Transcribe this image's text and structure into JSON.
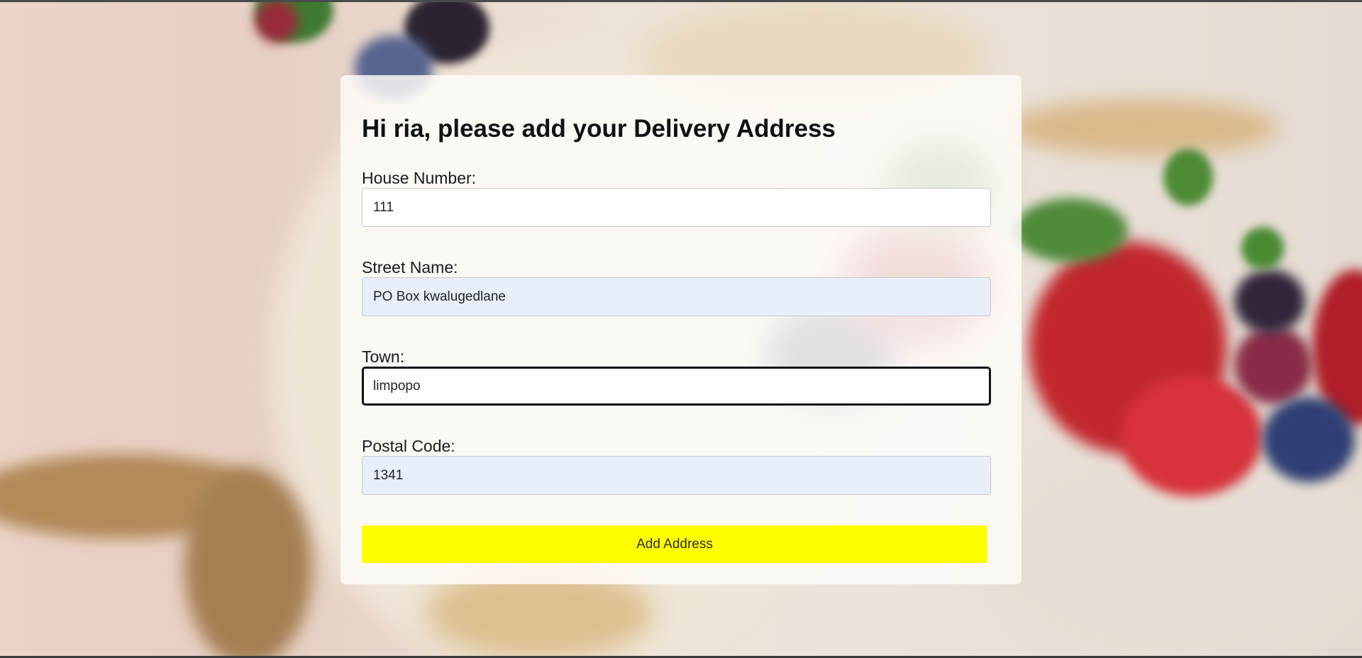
{
  "form": {
    "title": "Hi ria, please add your Delivery Address",
    "house_number": {
      "label": "House Number:",
      "value": "111"
    },
    "street_name": {
      "label": "Street Name:",
      "value": "PO Box kwalugedlane"
    },
    "town": {
      "label": "Town:",
      "value": "limpopo"
    },
    "postal_code": {
      "label": "Postal Code:",
      "value": "1341"
    },
    "submit_label": "Add Address",
    "submit_color": "#ffff00"
  }
}
